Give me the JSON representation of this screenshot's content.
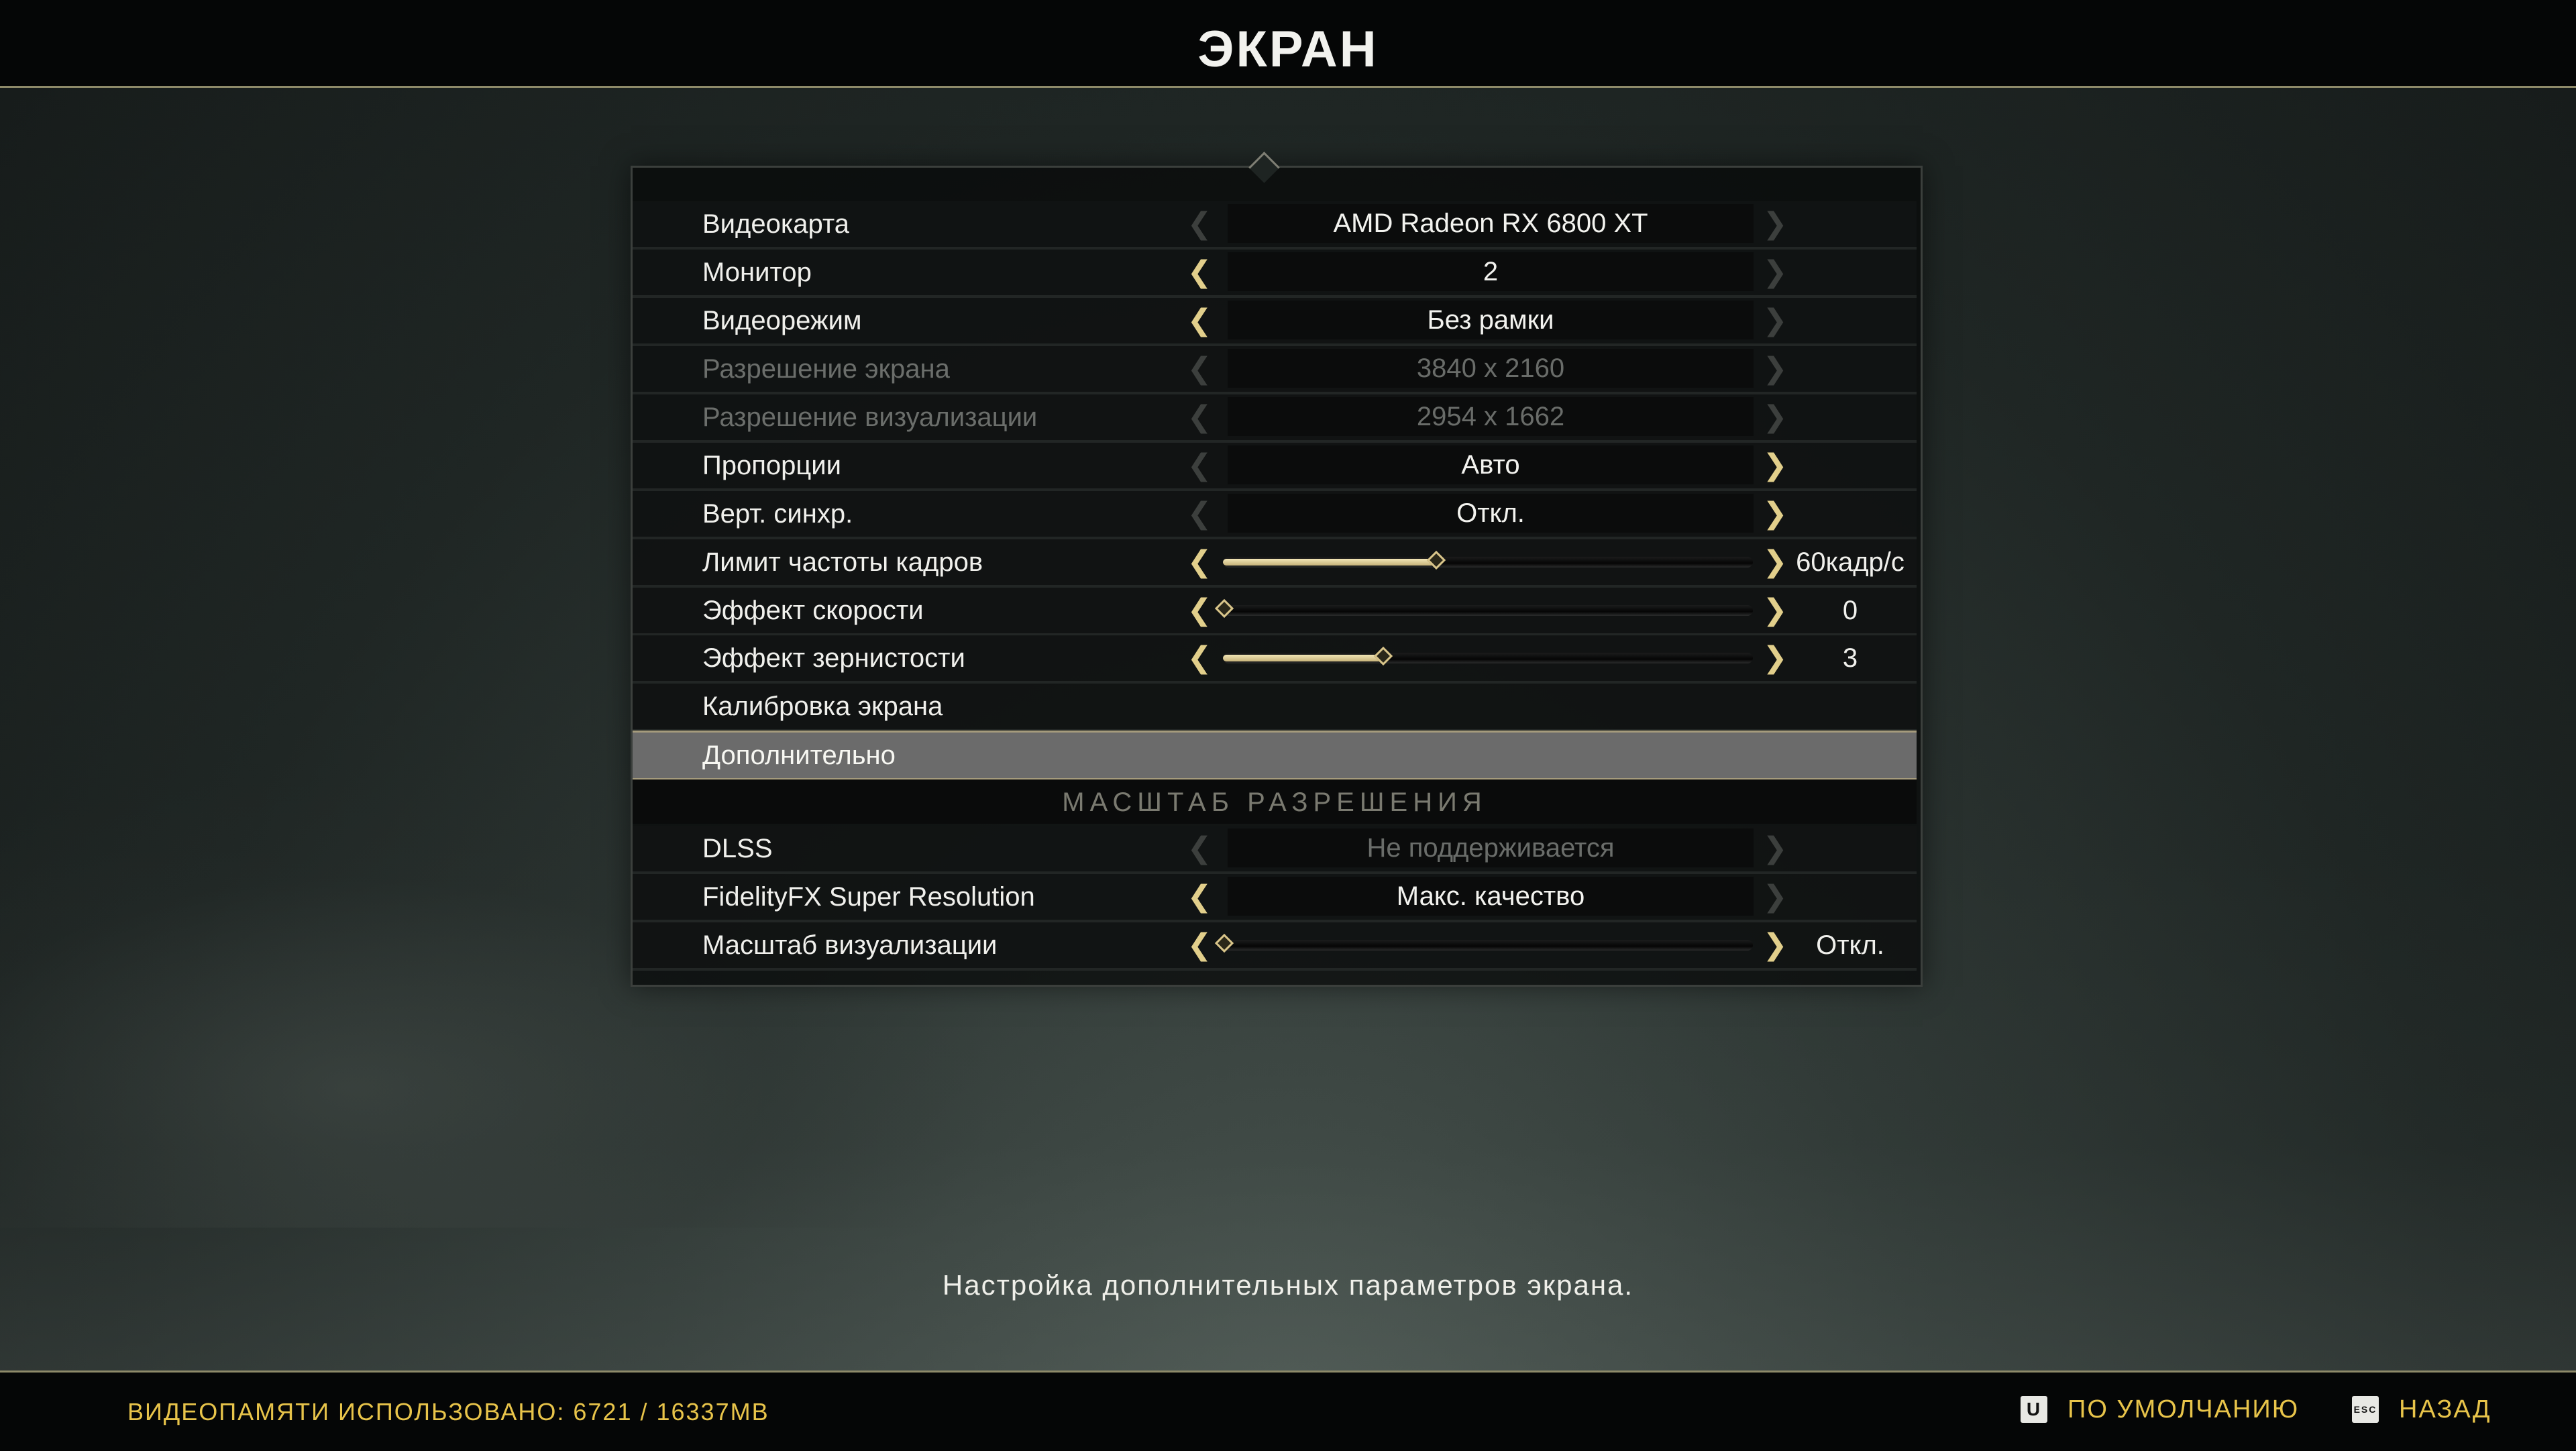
{
  "header": {
    "title": "ЭКРАН"
  },
  "settings": [
    {
      "label": "Видеокарта",
      "value": "AMD Radeon RX 6800 XT",
      "disabled": false,
      "left_active": false,
      "right_active": false
    },
    {
      "label": "Монитор",
      "value": "2",
      "disabled": false,
      "left_active": true,
      "right_active": false
    },
    {
      "label": "Видеорежим",
      "value": "Без рамки",
      "disabled": false,
      "left_active": true,
      "right_active": false
    },
    {
      "label": "Разрешение экрана",
      "value": "3840 x 2160",
      "disabled": true,
      "left_active": false,
      "right_active": false
    },
    {
      "label": "Разрешение визуализации",
      "value": "2954 x 1662",
      "disabled": true,
      "left_active": false,
      "right_active": false
    },
    {
      "label": "Пропорции",
      "value": "Авто",
      "disabled": false,
      "left_active": false,
      "right_active": true
    },
    {
      "label": "Верт. синхр.",
      "value": "Откл.",
      "disabled": false,
      "left_active": false,
      "right_active": true
    }
  ],
  "sliders": [
    {
      "label": "Лимит частоты кадров",
      "display": "60кадр/с",
      "level": 0.4
    },
    {
      "label": "Эффект скорости",
      "display": "0",
      "level": 0.0
    },
    {
      "label": "Эффект зернистости",
      "display": "3",
      "level": 0.3
    }
  ],
  "links": {
    "calibration": "Калибровка экрана",
    "advanced": "Дополнительно"
  },
  "resolution_scale": {
    "section_title": "МАСШТАБ РАЗРЕШЕНИЯ",
    "dlss": {
      "label": "DLSS",
      "value": "Не поддерживается"
    },
    "fsr": {
      "label": "FidelityFX Super Resolution",
      "value": "Макс. качество"
    },
    "render_scale": {
      "label": "Масштаб визуализации",
      "display": "Откл.",
      "level": 0.0
    }
  },
  "hint": "Настройка дополнительных параметров экрана.",
  "footer": {
    "vram": "ВИДЕОПАМЯТИ ИСПОЛЬЗОВАНО: 6721 / 16337MB",
    "default_key": "U",
    "default_label": "ПО УМОЛЧАНИЮ",
    "back_key": "ESC",
    "back_label": "НАЗАД"
  },
  "colors": {
    "accent": "#e8c44a",
    "arrow": "#e2cf8b",
    "border_gold": "#8e8a69"
  },
  "icons": {
    "left_arrow": "chevron-left-icon",
    "right_arrow": "chevron-right-icon",
    "slider_thumb": "diamond-icon"
  }
}
